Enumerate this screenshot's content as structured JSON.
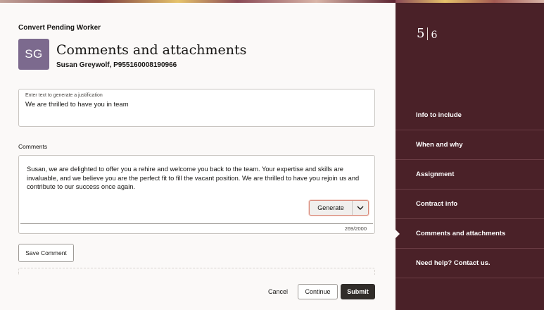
{
  "header": {
    "breadcrumb": "Convert Pending Worker",
    "avatar_initials": "SG",
    "title": "Comments and attachments",
    "subtitle": "Susan Greywolf, P955160008190966"
  },
  "justification": {
    "label": "Enter text to generate a justification",
    "value": "We are thrilled to have you in team"
  },
  "comments": {
    "label": "Comments",
    "text": "Susan, we are delighted to offer you a rehire and welcome you back to the team. Your expertise and skills are invaluable, and we believe you are the perfect fit to fill the vacant position. We are thrilled to have you rejoin us and contribute to our success once again.",
    "generate_label": "Generate",
    "counter": "269/2000"
  },
  "buttons": {
    "save_comment": "Save Comment",
    "cancel": "Cancel",
    "continue": "Continue",
    "submit": "Submit"
  },
  "progress": {
    "current": "5",
    "total": "6"
  },
  "side_nav": {
    "items": [
      {
        "label": "Info to include",
        "active": false
      },
      {
        "label": "When and why",
        "active": false
      },
      {
        "label": "Assignment",
        "active": false
      },
      {
        "label": "Contract info",
        "active": false
      },
      {
        "label": "Comments and attachments",
        "active": true
      },
      {
        "label": "Need help? Contact us.",
        "active": false
      }
    ]
  },
  "colors": {
    "side_panel": "#4a2128",
    "avatar": "#7c6a8e",
    "submit": "#312d2a"
  }
}
